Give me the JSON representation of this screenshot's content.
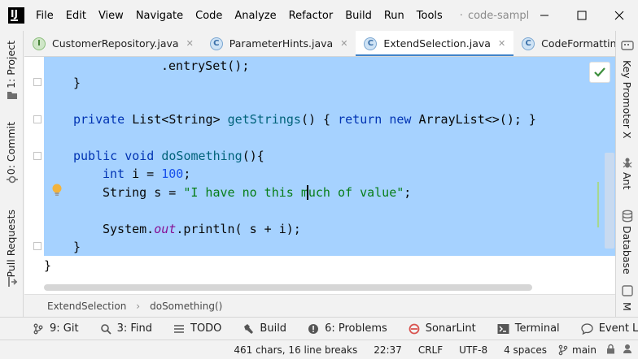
{
  "app": {
    "project_name": "code-sampl"
  },
  "menu": [
    "File",
    "Edit",
    "View",
    "Navigate",
    "Code",
    "Analyze",
    "Refactor",
    "Build",
    "Run",
    "Tools"
  ],
  "tabs": [
    {
      "label": "CustomerRepository.java",
      "icon_letter": "I"
    },
    {
      "label": "ParameterHints.java",
      "icon_letter": "C"
    },
    {
      "label": "ExtendSelection.java",
      "icon_letter": "C"
    },
    {
      "label": "CodeFormatting.java",
      "icon_letter": "C"
    }
  ],
  "left_tools": {
    "project": "1: Project",
    "commit": "0: Commit",
    "pull_requests": "Pull Requests"
  },
  "right_tools": {
    "key_promoter": "Key Promoter X",
    "ant": "Ant",
    "database": "Database",
    "maven": "M"
  },
  "code": {
    "l1": ".entrySet();",
    "l2": "}",
    "l3_kw1": "private",
    "l3_type": "List<String>",
    "l3_fn": "getStrings",
    "l3_rest1": "() { ",
    "l3_kw2": "return",
    "l3_kw3": "new",
    "l3_rest2": "ArrayList<>(); }",
    "l4_kw1": "public",
    "l4_kw2": "void",
    "l4_fn": "doSomething",
    "l4_rest": "(){",
    "l5_kw": "int",
    "l5_mid": "i = ",
    "l5_num": "100",
    "l5_end": ";",
    "l6_type": "String s = ",
    "l6_str": "\"I have no this much of value\"",
    "l6_end": ";",
    "l7_obj": "System.",
    "l7_field": "out",
    "l7_rest": ".println( s + i);",
    "l8": "}",
    "l9": "}"
  },
  "breadcrumb": {
    "class_name": "ExtendSelection",
    "method_name": "doSomething()"
  },
  "tool_windows": {
    "git": "9: Git",
    "find": "3: Find",
    "todo": "TODO",
    "build": "Build",
    "problems": "6: Problems",
    "sonarlint": "SonarLint",
    "terminal": "Terminal",
    "event_log": "Event Log"
  },
  "status": {
    "selection_info": "461 chars, 16 line breaks",
    "position": "22:37",
    "line_separator": "CRLF",
    "encoding": "UTF-8",
    "indent": "4 spaces",
    "branch": "main"
  },
  "colors": {
    "selection": "#a6d2ff",
    "keyword": "#0033b3",
    "string": "#067d17",
    "accent": "#4083c9"
  }
}
